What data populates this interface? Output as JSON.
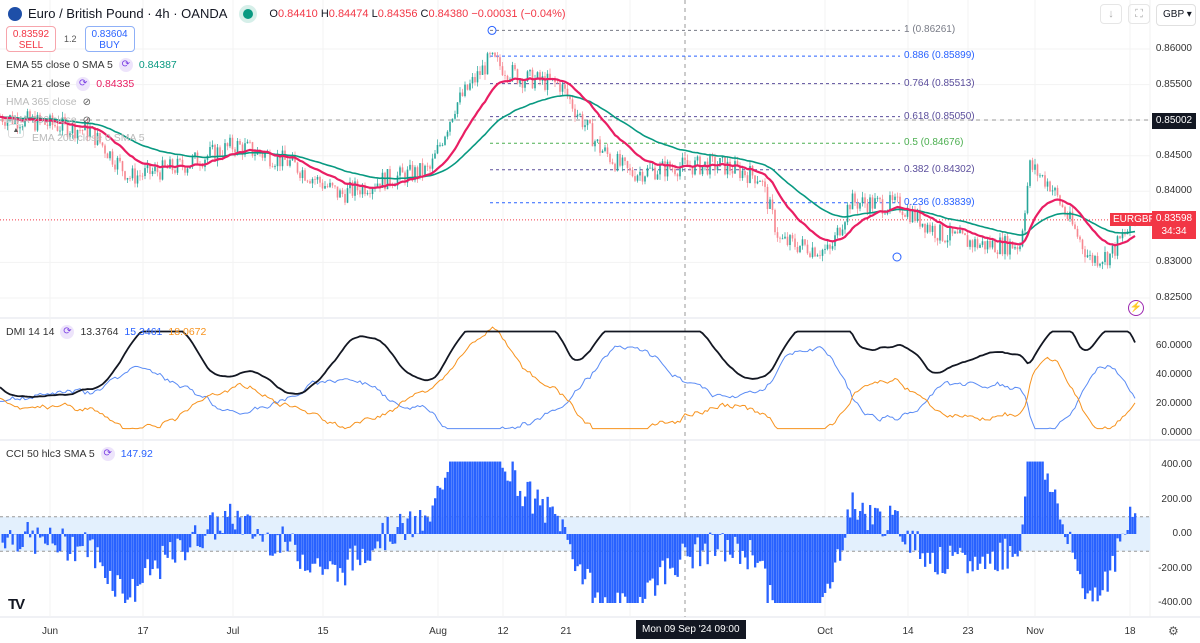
{
  "header": {
    "title": "Euro / British Pound · 4h · OANDA",
    "open": "0.84410",
    "high": "0.84474",
    "low": "0.84356",
    "close": "0.84380",
    "change": "−0.00031 (−0.04%)",
    "o": "O",
    "h": "H",
    "l": "L",
    "c": "C"
  },
  "trade": {
    "sell_price": "0.83592",
    "sell_label": "SELL",
    "spread": "1.2",
    "buy_price": "0.83604",
    "buy_label": "BUY"
  },
  "legends": {
    "ema55": {
      "label": "EMA 55 close 0 SMA 5",
      "value": "0.84387"
    },
    "ema21": {
      "label": "EMA 21 close",
      "value": "0.84335"
    },
    "hma365": {
      "label": "HMA 365 close"
    },
    "hma200": {
      "label": "HMA 200 close"
    },
    "ema200": {
      "label": "EMA 200 close 0 SMA 5"
    },
    "dmi": {
      "label": "DMI 14 14",
      "adx": "13.3764",
      "plus": "15.3461",
      "minus": "18.0672"
    },
    "cci": {
      "label": "CCI 50 hlc3 SMA 5",
      "value": "147.92"
    }
  },
  "toolbar": {
    "currency": "GBP",
    "down_icon": "arrow-down-icon",
    "fullscreen_icon": "fullscreen-icon"
  },
  "price_scale": {
    "labels": [
      "0.86000",
      "0.85500",
      "0.85000",
      "0.84500",
      "0.84000",
      "0.83000",
      "0.82500"
    ],
    "values": [
      0.86,
      0.855,
      0.85,
      0.845,
      0.84,
      0.83,
      0.825
    ],
    "crosshair": "0.85002",
    "last": "0.83598",
    "countdown": "34:34",
    "symbol": "EURGBP"
  },
  "dmi_scale": {
    "labels": [
      "60.0000",
      "40.0000",
      "20.0000",
      "0.0000"
    ],
    "values": [
      60,
      40,
      20,
      0
    ]
  },
  "cci_scale": {
    "labels": [
      "400.00",
      "200.00",
      "0.00",
      "-200.00",
      "-400.00"
    ],
    "values": [
      400,
      200,
      0,
      -200,
      -400
    ]
  },
  "time_axis": {
    "labels": [
      "Jun",
      "17",
      "Jul",
      "15",
      "Aug",
      "12",
      "21",
      "Oct",
      "14",
      "23",
      "Nov",
      "18"
    ],
    "crosshair": "Mon 09 Sep '24   09:00"
  },
  "fib": [
    {
      "label": "1 (0.86261)",
      "price": 0.86261,
      "color": "#787b86"
    },
    {
      "label": "0.886 (0.85899)",
      "price": 0.85899,
      "color": "#2962ff"
    },
    {
      "label": "0.764 (0.85513)",
      "price": 0.85513,
      "color": "#5b4e9c"
    },
    {
      "label": "0.618 (0.85050)",
      "price": 0.8505,
      "color": "#5b4e9c"
    },
    {
      "label": "0.5 (0.84676)",
      "price": 0.84676,
      "color": "#4caf50"
    },
    {
      "label": "0.382 (0.84302)",
      "price": 0.84302,
      "color": "#5b4e9c"
    },
    {
      "label": "0.236 (0.83839)",
      "price": 0.83839,
      "color": "#2962ff"
    }
  ],
  "colors": {
    "up": "#26a69a",
    "down": "#f7868f",
    "ema55": "#089981",
    "ema21": "#e91e63",
    "adx": "#131722",
    "plus": "#5b8cf5",
    "minus": "#f7931e",
    "cci": "#2962ff"
  },
  "chart_data": {
    "type": "candlestick",
    "price_path": [
      [
        0,
        0.8505
      ],
      [
        90,
        0.8485
      ],
      [
        130,
        0.842
      ],
      [
        180,
        0.8435
      ],
      [
        235,
        0.8465
      ],
      [
        290,
        0.844
      ],
      [
        340,
        0.8395
      ],
      [
        380,
        0.8415
      ],
      [
        430,
        0.843
      ],
      [
        455,
        0.852
      ],
      [
        490,
        0.8585
      ],
      [
        520,
        0.856
      ],
      [
        560,
        0.855
      ],
      [
        600,
        0.846
      ],
      [
        630,
        0.8425
      ],
      [
        680,
        0.8435
      ],
      [
        720,
        0.8437
      ],
      [
        760,
        0.842
      ],
      [
        780,
        0.833
      ],
      [
        830,
        0.8315
      ],
      [
        850,
        0.8385
      ],
      [
        900,
        0.838
      ],
      [
        940,
        0.834
      ],
      [
        980,
        0.8325
      ],
      [
        1020,
        0.8325
      ],
      [
        1030,
        0.8435
      ],
      [
        1050,
        0.841
      ],
      [
        1090,
        0.8305
      ],
      [
        1110,
        0.831
      ],
      [
        1135,
        0.836
      ]
    ]
  }
}
